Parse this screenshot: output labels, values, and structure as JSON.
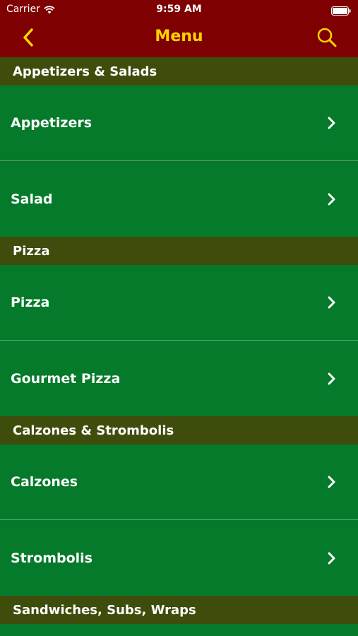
{
  "status_bar": {
    "carrier": "Carrier",
    "time": "9:59 AM"
  },
  "nav": {
    "title": "Menu",
    "back_icon": "chevron-left-icon",
    "search_icon": "search-icon"
  },
  "colors": {
    "header_bg": "#7e0000",
    "title": "#ffd400",
    "section_bg": "#3e4d0c",
    "row_bg": "#047a2a"
  },
  "sections": [
    {
      "title": "Appetizers & Salads",
      "items": [
        "Appetizers",
        "Salad"
      ]
    },
    {
      "title": "Pizza",
      "items": [
        "Pizza",
        "Gourmet Pizza"
      ]
    },
    {
      "title": "Calzones & Strombolis",
      "items": [
        "Calzones",
        "Strombolis"
      ]
    },
    {
      "title": "Sandwiches, Subs, Wraps",
      "items": []
    }
  ]
}
